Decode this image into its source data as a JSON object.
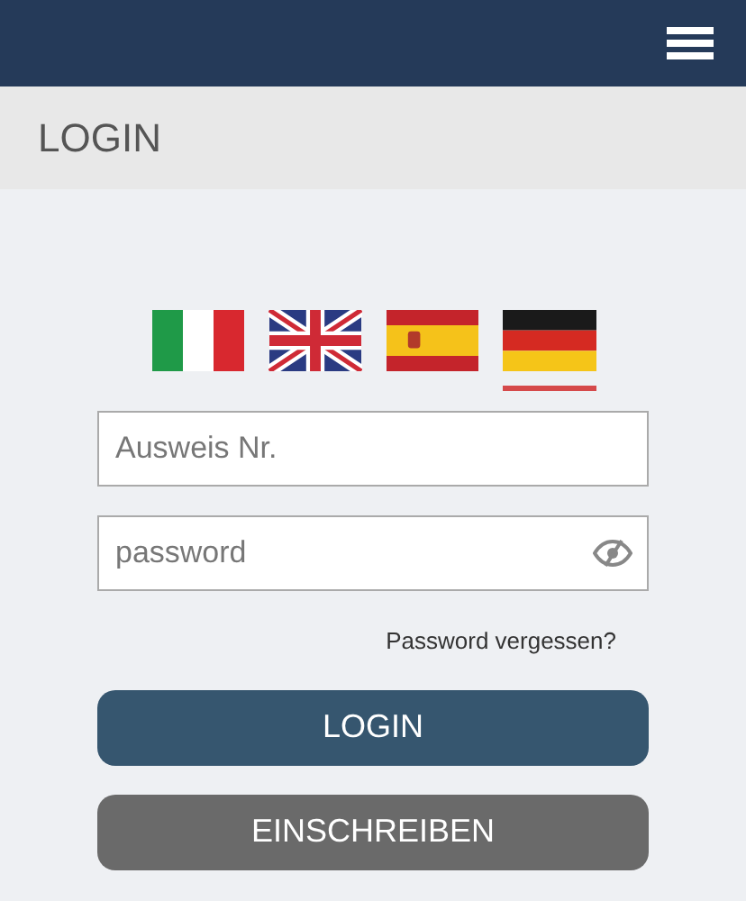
{
  "page_title": "LOGIN",
  "languages": [
    {
      "kind": "it",
      "selected": false
    },
    {
      "kind": "gb",
      "selected": false
    },
    {
      "kind": "es",
      "selected": false
    },
    {
      "kind": "de",
      "selected": true
    }
  ],
  "id_field": {
    "placeholder": "Ausweis Nr."
  },
  "password_field": {
    "placeholder": "password"
  },
  "forgot_link": "Password vergessen?",
  "buttons": [
    {
      "kind": "primary",
      "label": "LOGIN"
    },
    {
      "kind": "secondary",
      "label": "EINSCHREIBEN"
    }
  ]
}
